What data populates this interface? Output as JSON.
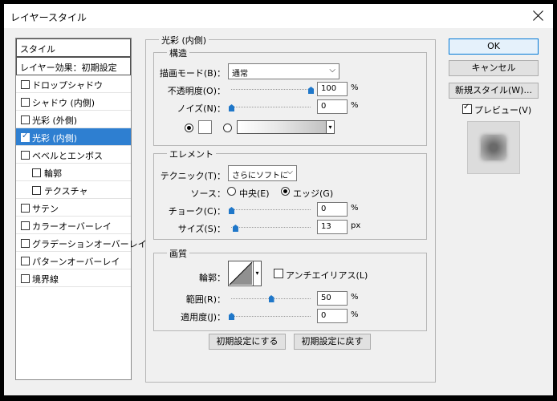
{
  "window": {
    "title": "レイヤースタイル"
  },
  "style_list": {
    "header": "スタイル",
    "preset": "レイヤー効果：初期設定",
    "items": [
      {
        "label": "ドロップシャドウ",
        "checked": false
      },
      {
        "label": "シャドウ (内側)",
        "checked": false
      },
      {
        "label": "光彩 (外側)",
        "checked": false
      },
      {
        "label": "光彩 (内側)",
        "checked": true
      },
      {
        "label": "ベベルとエンボス",
        "checked": false
      },
      {
        "label": "輪郭",
        "checked": false
      },
      {
        "label": "テクスチャ",
        "checked": false
      },
      {
        "label": "サテン",
        "checked": false
      },
      {
        "label": "カラーオーバーレイ",
        "checked": false
      },
      {
        "label": "グラデーションオーバーレイ",
        "checked": false
      },
      {
        "label": "パターンオーバーレイ",
        "checked": false
      },
      {
        "label": "境界線",
        "checked": false
      }
    ]
  },
  "panel": {
    "title": "光彩 (内側)",
    "structure": {
      "title": "構造",
      "blend_mode_label": "描画モード(B)：",
      "blend_mode_value": "通常",
      "opacity_label": "不透明度(O)：",
      "opacity_value": "100",
      "opacity_fraction": 1.0,
      "noise_label": "ノイズ(N)：",
      "noise_value": "0",
      "noise_fraction": 0,
      "percent": "%"
    },
    "elements": {
      "title": "エレメント",
      "technique_label": "テクニック(T)：",
      "technique_value": "さらにソフトに",
      "source_label": "ソース：",
      "source_center": "中央(E)",
      "source_edge": "エッジ(G)",
      "choke_label": "チョーク(C)：",
      "choke_value": "0",
      "choke_fraction": 0,
      "size_label": "サイズ(S)：",
      "size_value": "13",
      "size_fraction": 0.05,
      "percent": "%",
      "px": "px"
    },
    "quality": {
      "title": "画質",
      "contour_label": "輪郭：",
      "antialias_label": "アンチエイリアス(L)",
      "range_label": "範囲(R)：",
      "range_value": "50",
      "range_fraction": 0.5,
      "jitter_label": "適用度(J)：",
      "jitter_value": "0",
      "jitter_fraction": 0,
      "percent": "%"
    },
    "make_default": "初期設定にする",
    "reset_default": "初期設定に戻す"
  },
  "buttons": {
    "ok": "OK",
    "cancel": "キャンセル",
    "new_style": "新規スタイル(W)...",
    "preview": "プレビュー(V)"
  },
  "colors": {
    "accent": "#1f77c9",
    "selected": "#2e7fd1",
    "glow": "#ffffff"
  }
}
